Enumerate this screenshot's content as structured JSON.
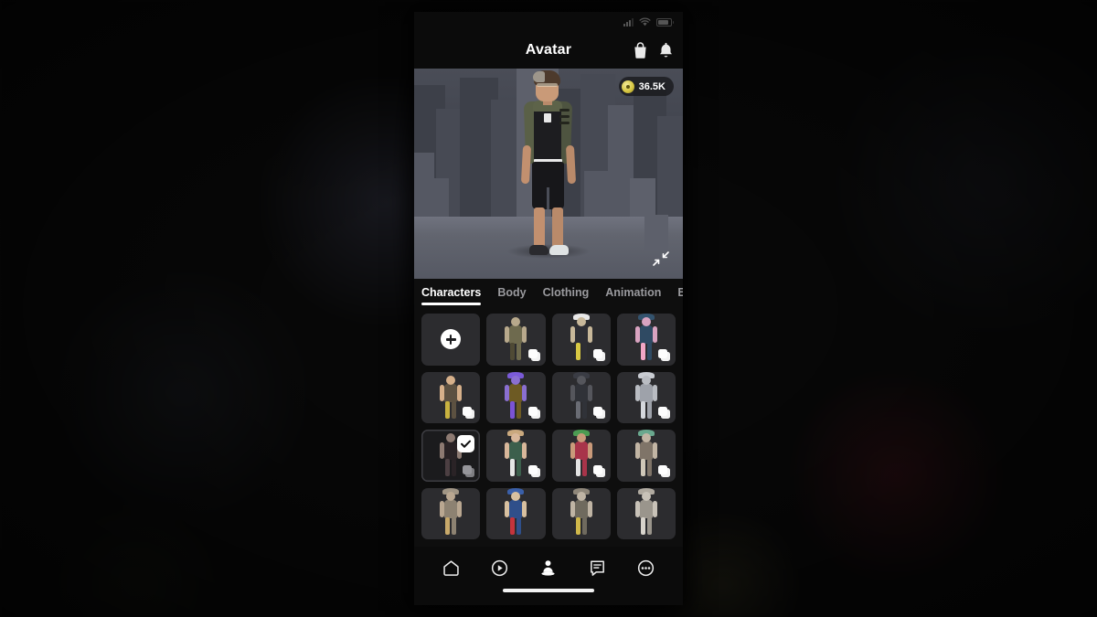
{
  "status_bar": {
    "signal_icon": "cellular-signal-icon",
    "wifi_icon": "wifi-icon",
    "battery_icon": "battery-icon"
  },
  "header": {
    "title": "Avatar",
    "shop_icon": "shopping-bag-icon",
    "notification_icon": "bell-icon"
  },
  "viewport": {
    "currency": {
      "value": "36.5K",
      "icon": "coin-icon",
      "color": "#d8c843"
    },
    "collapse_icon": "collapse-arrows-icon"
  },
  "tabs": [
    {
      "label": "Characters",
      "active": true
    },
    {
      "label": "Body",
      "active": false
    },
    {
      "label": "Clothing",
      "active": false
    },
    {
      "label": "Animation",
      "active": false
    },
    {
      "label": "E",
      "active": false
    }
  ],
  "grid": {
    "add_button_label": "add-character",
    "cells": [
      {
        "kind": "add",
        "name": "add-character-button"
      },
      {
        "kind": "character",
        "name": "character-tile-1",
        "skin": "#b8a98c",
        "outfit": "#6e6a4e",
        "accent": "#4f4a35",
        "hat": null,
        "selected": false,
        "badge": "copy"
      },
      {
        "kind": "character",
        "name": "character-tile-2",
        "skin": "#c8b89a",
        "outfit": "#2e2e34",
        "accent": "#d8c843",
        "hat": "#e8e8e8",
        "selected": false,
        "badge": "copy"
      },
      {
        "kind": "character",
        "name": "character-tile-3",
        "skin": "#d9a3c0",
        "outfit": "#2f4a63",
        "accent": "#f2a6c6",
        "hat": "#33536e",
        "selected": false,
        "badge": "copy"
      },
      {
        "kind": "character",
        "name": "character-tile-4",
        "skin": "#d6b08a",
        "outfit": "#5c5141",
        "accent": "#c9b23f",
        "hat": null,
        "selected": false,
        "badge": "copy"
      },
      {
        "kind": "character",
        "name": "character-tile-5",
        "skin": "#8a6fd0",
        "outfit": "#6d5a23",
        "accent": "#7b53d6",
        "hat": "#7a5ad8",
        "selected": false,
        "badge": "copy"
      },
      {
        "kind": "character",
        "name": "character-tile-6",
        "skin": "#55565c",
        "outfit": "#303238",
        "accent": "#6a6c74",
        "hat": "#3a3c44",
        "selected": false,
        "badge": "copy"
      },
      {
        "kind": "character",
        "name": "character-tile-7",
        "skin": "#b9bcc2",
        "outfit": "#9ea2aa",
        "accent": "#d5d8dd",
        "hat": "#c9ccd2",
        "selected": false,
        "badge": "copy"
      },
      {
        "kind": "character",
        "name": "character-tile-8",
        "skin": "#8d7a72",
        "outfit": "#2a2326",
        "accent": "#4c3f42",
        "hat": null,
        "selected": true,
        "badge": "copy-dim"
      },
      {
        "kind": "character",
        "name": "character-tile-9",
        "skin": "#d8b79a",
        "outfit": "#3c5f4c",
        "accent": "#e6e6e6",
        "hat": "#caa97e",
        "selected": false,
        "badge": "copy"
      },
      {
        "kind": "character",
        "name": "character-tile-10",
        "skin": "#c99a7a",
        "outfit": "#a8344a",
        "accent": "#e4e4e4",
        "hat": "#4c9c52",
        "selected": false,
        "badge": "copy"
      },
      {
        "kind": "character",
        "name": "character-tile-11",
        "skin": "#c2b5a4",
        "outfit": "#7f7468",
        "accent": "#cfc7b8",
        "hat": "#6aa88e",
        "selected": false,
        "badge": "copy"
      },
      {
        "kind": "character",
        "name": "character-tile-12",
        "skin": "#b9a791",
        "outfit": "#8d8272",
        "accent": "#c8a96a",
        "hat": "#a09585",
        "selected": false,
        "badge": "none"
      },
      {
        "kind": "character",
        "name": "character-tile-13",
        "skin": "#d8c0a0",
        "outfit": "#2f4f8a",
        "accent": "#c4343c",
        "hat": "#3a5fa8",
        "selected": false,
        "badge": "none"
      },
      {
        "kind": "character",
        "name": "character-tile-14",
        "skin": "#bfb4a4",
        "outfit": "#6f6a5e",
        "accent": "#d0b84a",
        "hat": "#8e8679",
        "selected": false,
        "badge": "none"
      },
      {
        "kind": "character",
        "name": "character-tile-15",
        "skin": "#c8c2b8",
        "outfit": "#9a958c",
        "accent": "#d8d4cc",
        "hat": "#b0aaa0",
        "selected": false,
        "badge": "none"
      }
    ]
  },
  "bottom_nav": [
    {
      "name": "nav-home",
      "icon": "home-icon",
      "active": false
    },
    {
      "name": "nav-play",
      "icon": "play-circle-icon",
      "active": false
    },
    {
      "name": "nav-avatar",
      "icon": "avatar-icon",
      "active": true
    },
    {
      "name": "nav-messages",
      "icon": "chat-icon",
      "active": false
    },
    {
      "name": "nav-more",
      "icon": "ellipsis-circle-icon",
      "active": false
    }
  ],
  "home_indicator": "home-indicator"
}
